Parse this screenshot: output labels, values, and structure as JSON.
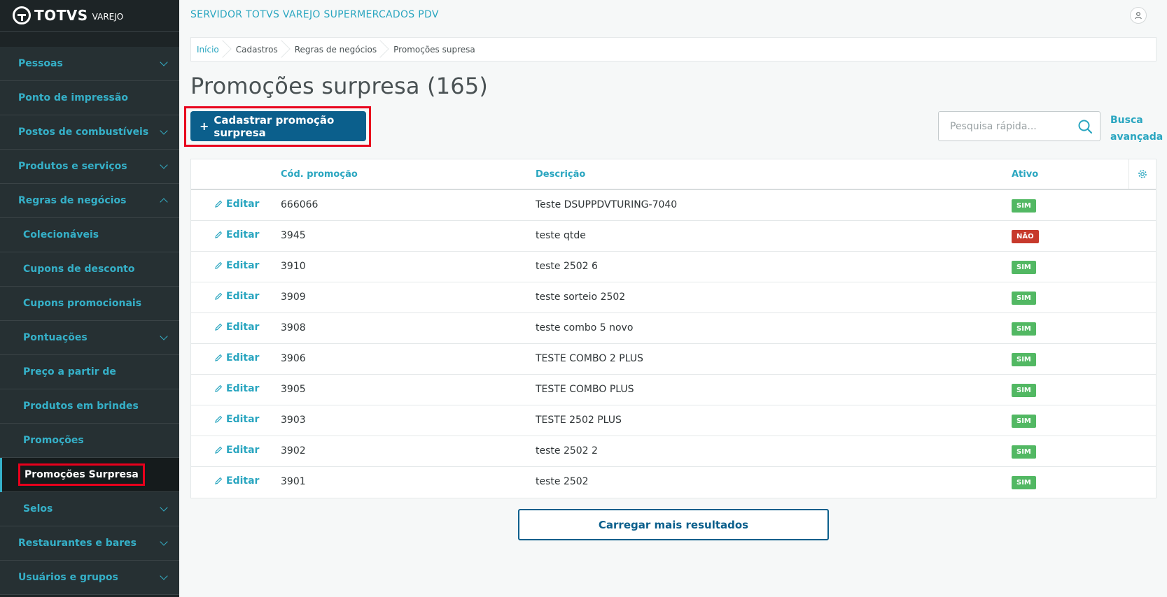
{
  "brand": {
    "name": "TOTVS",
    "sub": "VAREJO"
  },
  "header": {
    "title": "SERVIDOR TOTVS VAREJO SUPERMERCADOS PDV"
  },
  "sidebar": {
    "items": [
      {
        "label": "Pessoas",
        "type": "top",
        "chevron": "down"
      },
      {
        "label": "Ponto de impressão",
        "type": "top"
      },
      {
        "label": "Postos de combustíveis",
        "type": "top",
        "chevron": "down"
      },
      {
        "label": "Produtos e serviços",
        "type": "top",
        "chevron": "down"
      },
      {
        "label": "Regras de negócios",
        "type": "top",
        "chevron": "up"
      },
      {
        "label": "Colecionáveis",
        "type": "sub"
      },
      {
        "label": "Cupons de desconto",
        "type": "sub"
      },
      {
        "label": "Cupons promocionais",
        "type": "sub"
      },
      {
        "label": "Pontuações",
        "type": "sub",
        "chevron": "down"
      },
      {
        "label": "Preço a partir de",
        "type": "sub"
      },
      {
        "label": "Produtos em brindes",
        "type": "sub"
      },
      {
        "label": "Promoções",
        "type": "sub"
      },
      {
        "label": "Promoções Surpresa",
        "type": "sub",
        "active": true
      },
      {
        "label": "Selos",
        "type": "sub",
        "chevron": "down"
      },
      {
        "label": "Restaurantes e bares",
        "type": "top",
        "chevron": "down"
      },
      {
        "label": "Usuários e grupos",
        "type": "top",
        "chevron": "down"
      }
    ]
  },
  "breadcrumb": [
    "Início",
    "Cadastros",
    "Regras de negócios",
    "Promoções supresa"
  ],
  "page": {
    "title": "Promoções surpresa (165)",
    "new_button": "Cadastrar promoção surpresa",
    "search_placeholder": "Pesquisa rápida...",
    "advanced_search": "Busca avançada",
    "load_more": "Carregar mais resultados"
  },
  "table": {
    "columns": [
      "Cód. promoção",
      "Descrição",
      "Ativo"
    ],
    "edit_label": "Editar",
    "rows": [
      {
        "code": "666066",
        "description": "Teste DSUPPDVTURING-7040",
        "active": "SIM"
      },
      {
        "code": "3945",
        "description": "teste qtde",
        "active": "NÃO"
      },
      {
        "code": "3910",
        "description": "teste 2502 6",
        "active": "SIM"
      },
      {
        "code": "3909",
        "description": "teste sorteio 2502",
        "active": "SIM"
      },
      {
        "code": "3908",
        "description": "teste combo 5 novo",
        "active": "SIM"
      },
      {
        "code": "3906",
        "description": "TESTE COMBO 2 PLUS",
        "active": "SIM"
      },
      {
        "code": "3905",
        "description": "TESTE COMBO PLUS",
        "active": "SIM"
      },
      {
        "code": "3903",
        "description": "TESTE 2502 PLUS",
        "active": "SIM"
      },
      {
        "code": "3902",
        "description": "teste 2502 2",
        "active": "SIM"
      },
      {
        "code": "3901",
        "description": "teste 2502",
        "active": "SIM"
      }
    ]
  },
  "colors": {
    "accent": "#2aa6c0",
    "primary": "#0b5f8c",
    "sidebar": "#263033",
    "yes": "#52b863",
    "no": "#c7392c",
    "highlight": "#e8001c"
  }
}
